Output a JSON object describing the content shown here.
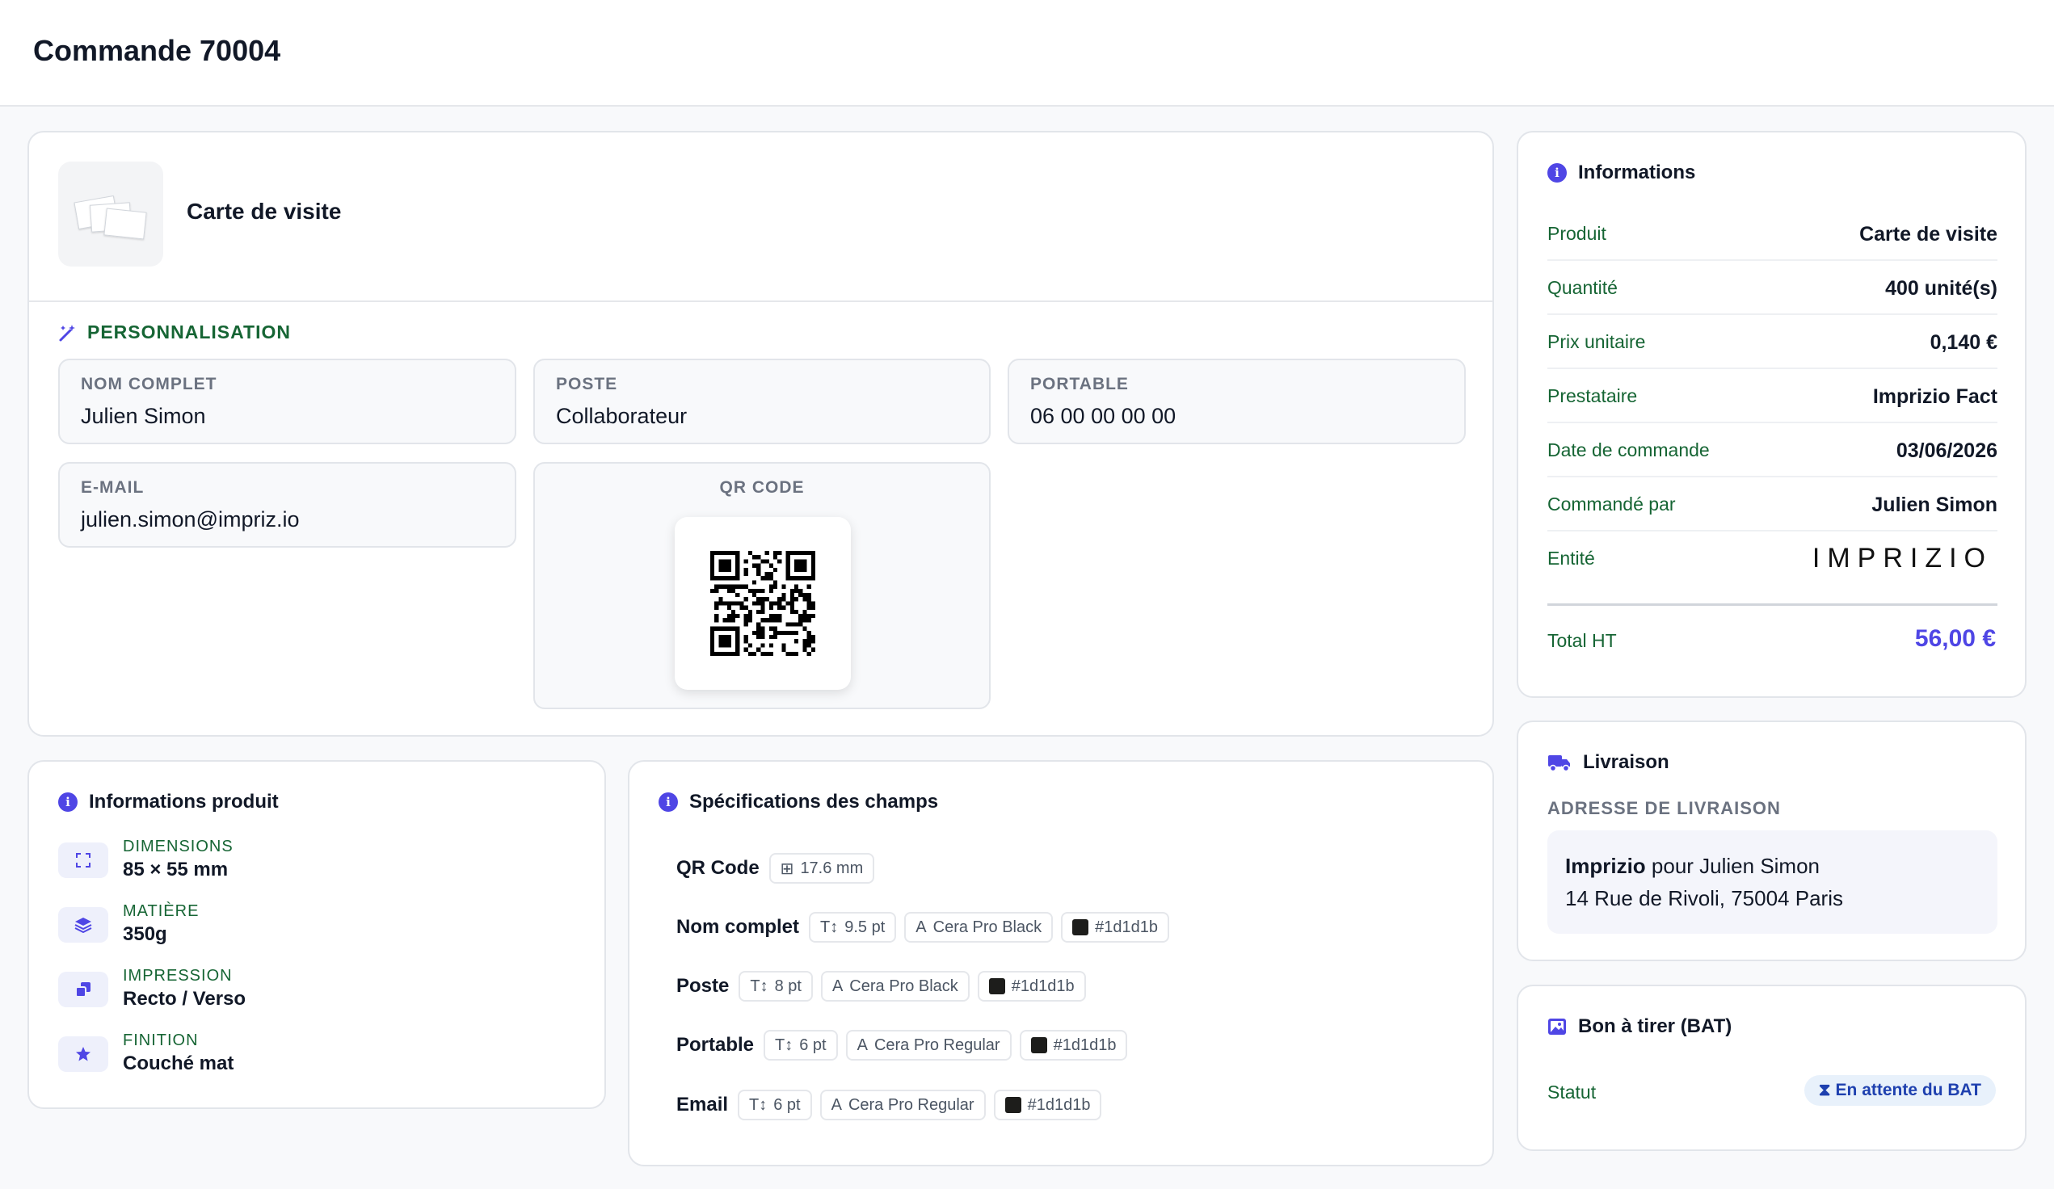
{
  "page": {
    "title": "Commande 70004"
  },
  "product": {
    "name": "Carte de visite"
  },
  "personnalisation": {
    "title": "PERSONNALISATION",
    "fields": {
      "nom": {
        "label": "NOM COMPLET",
        "value": "Julien Simon"
      },
      "poste": {
        "label": "POSTE",
        "value": "Collaborateur"
      },
      "portable": {
        "label": "PORTABLE",
        "value": "06 00 00 00 00"
      },
      "email": {
        "label": "E-MAIL",
        "value": "julien.simon@impriz.io"
      },
      "qr": {
        "label": "QR CODE"
      }
    }
  },
  "informations": {
    "title": "Informations",
    "rows": [
      {
        "key": "Produit",
        "value": "Carte de visite"
      },
      {
        "key": "Quantité",
        "value": "400 unité(s)"
      },
      {
        "key": "Prix unitaire",
        "value": "0,140 €"
      },
      {
        "key": "Prestataire",
        "value": "Imprizio Fact"
      },
      {
        "key": "Date de commande",
        "value": "03/06/2026"
      },
      {
        "key": "Commandé par",
        "value": "Julien Simon"
      },
      {
        "key": "Entité",
        "value": "IMPRIZIO"
      }
    ],
    "total_label": "Total HT",
    "total_value": "56,00 €"
  },
  "livraison": {
    "title": "Livraison",
    "address_label": "ADRESSE DE LIVRAISON",
    "company": "Imprizio",
    "for_text": " pour Julien Simon",
    "street": "14 Rue de Rivoli, 75004 Paris"
  },
  "bat": {
    "title": "Bon à tirer (BAT)",
    "status_label": "Statut",
    "status_value": "En attente du BAT"
  },
  "info_produit": {
    "title": "Informations produit",
    "items": [
      {
        "key": "DIMENSIONS",
        "value": "85 × 55 mm",
        "icon": "expand-icon"
      },
      {
        "key": "MATIÈRE",
        "value": "350g",
        "icon": "layers-icon"
      },
      {
        "key": "IMPRESSION",
        "value": "Recto / Verso",
        "icon": "copy-icon"
      },
      {
        "key": "FINITION",
        "value": "Couché mat",
        "icon": "star-icon"
      }
    ]
  },
  "specs": {
    "title": "Spécifications des champs",
    "rows": [
      {
        "name": "QR Code",
        "chips": {
          "size": "17.6 mm"
        }
      },
      {
        "name": "Nom complet",
        "chips": {
          "size": "9.5 pt",
          "font": "Cera Pro Black",
          "color": "#1d1d1b"
        }
      },
      {
        "name": "Poste",
        "chips": {
          "size": "8 pt",
          "font": "Cera Pro Black",
          "color": "#1d1d1b"
        }
      },
      {
        "name": "Portable",
        "chips": {
          "size": "6 pt",
          "font": "Cera Pro Regular",
          "color": "#1d1d1b"
        }
      },
      {
        "name": "Email",
        "chips": {
          "size": "6 pt",
          "font": "Cera Pro Regular",
          "color": "#1d1d1b"
        }
      }
    ]
  },
  "colors": {
    "accent": "#4f46e5",
    "label_green": "#166534",
    "border": "#e2e5ea"
  }
}
